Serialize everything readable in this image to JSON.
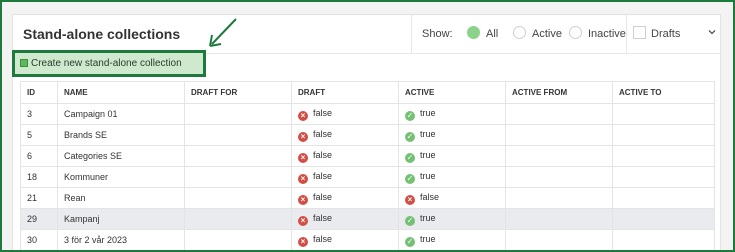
{
  "header": {
    "title": "Stand-alone collections",
    "show_label": "Show:",
    "filters": [
      "All",
      "Active",
      "Inactive"
    ],
    "selected_filter": "All",
    "drafts_label": "Drafts",
    "drafts_checked": false,
    "chevron_icon": "chevron-down-icon"
  },
  "create_button": {
    "label": "Create new stand-alone collection",
    "icon": "plus-icon"
  },
  "annotation": {
    "arrow_color": "#1e7a3c"
  },
  "table": {
    "columns": [
      "ID",
      "NAME",
      "DRAFT FOR",
      "DRAFT",
      "ACTIVE",
      "ACTIVE FROM",
      "ACTIVE TO"
    ],
    "rows": [
      {
        "id": "3",
        "name": "Campaign 01",
        "draft_for": "",
        "draft": "false",
        "active": "true",
        "active_from": "",
        "active_to": ""
      },
      {
        "id": "5",
        "name": "Brands SE",
        "draft_for": "",
        "draft": "false",
        "active": "true",
        "active_from": "",
        "active_to": ""
      },
      {
        "id": "6",
        "name": "Categories SE",
        "draft_for": "",
        "draft": "false",
        "active": "true",
        "active_from": "",
        "active_to": ""
      },
      {
        "id": "18",
        "name": "Kommuner",
        "draft_for": "",
        "draft": "false",
        "active": "true",
        "active_from": "",
        "active_to": ""
      },
      {
        "id": "21",
        "name": "Rean",
        "draft_for": "",
        "draft": "false",
        "active": "false",
        "active_from": "",
        "active_to": ""
      },
      {
        "id": "29",
        "name": "Kampanj",
        "draft_for": "",
        "draft": "false",
        "active": "true",
        "active_from": "",
        "active_to": "",
        "highlighted": true
      },
      {
        "id": "30",
        "name": "3 för 2 vår 2023",
        "draft_for": "",
        "draft": "false",
        "active": "true",
        "active_from": "",
        "active_to": ""
      }
    ]
  },
  "colors": {
    "accent_green": "#1e7a3c",
    "false_red": "#d34f46",
    "true_green": "#74c174",
    "radio_selected": "#8bd38b"
  }
}
